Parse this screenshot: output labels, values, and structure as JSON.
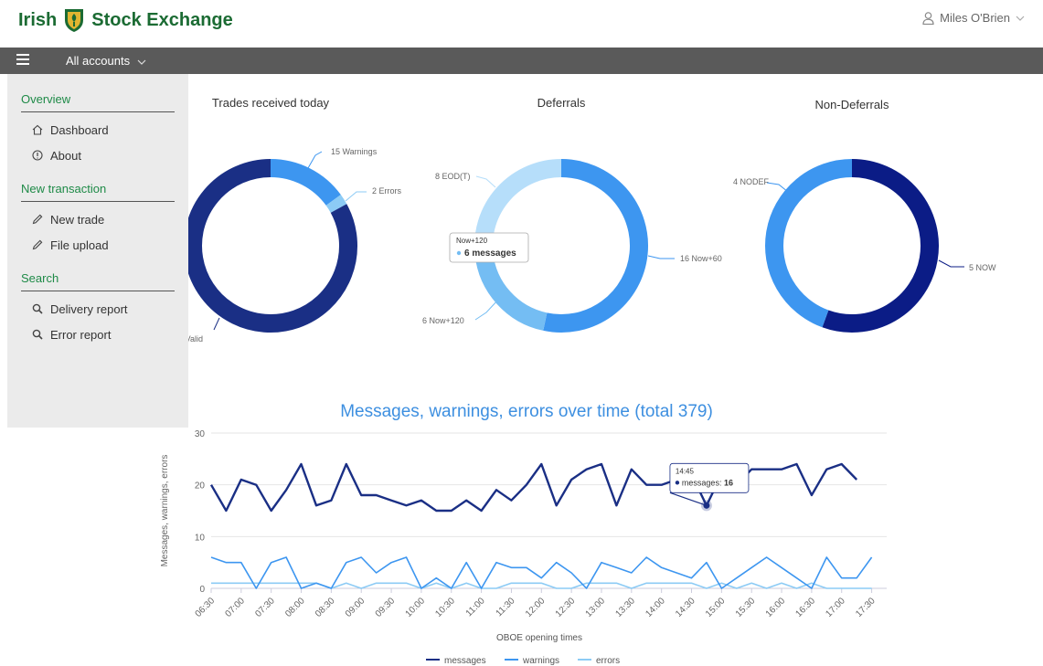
{
  "header": {
    "logo_left": "Irish",
    "logo_right": "Stock Exchange",
    "user_name": "Miles O'Brien"
  },
  "navbar": {
    "accounts_label": "All accounts"
  },
  "sidebar": {
    "sections": [
      {
        "title": "Overview",
        "items": [
          {
            "label": "Dashboard",
            "icon": "home-icon"
          },
          {
            "label": "About",
            "icon": "info-icon"
          }
        ]
      },
      {
        "title": "New transaction",
        "items": [
          {
            "label": "New trade",
            "icon": "pencil-icon"
          },
          {
            "label": "File upload",
            "icon": "pencil-icon"
          }
        ]
      },
      {
        "title": "Search",
        "items": [
          {
            "label": "Delivery report",
            "icon": "search-icon"
          },
          {
            "label": "Error report",
            "icon": "search-icon"
          }
        ]
      }
    ]
  },
  "colors": {
    "dark_blue": "#1a2f85",
    "mid_blue": "#3d96f0",
    "light_blue": "#8ccbf5",
    "navy": "#0b1c86",
    "title_blue": "#3d8fe0"
  },
  "chart_data": [
    {
      "type": "pie",
      "variant": "donut",
      "title": "Trades received today",
      "slices": [
        {
          "label": "Valid",
          "value": 83,
          "color": "#1a2f85"
        },
        {
          "label": "15 Warnings",
          "value": 15,
          "color": "#3d96f0"
        },
        {
          "label": "2 Errors",
          "value": 2,
          "color": "#8ccbf5"
        }
      ]
    },
    {
      "type": "pie",
      "variant": "donut",
      "title": "Deferrals",
      "tooltip": {
        "header": "Now+120",
        "value": "6 messages"
      },
      "slices": [
        {
          "label": "16 Now+60",
          "value": 16,
          "color": "#3d96f0"
        },
        {
          "label": "6 Now+120",
          "value": 6,
          "color": "#74bdf3"
        },
        {
          "label": "8 EOD(T)",
          "value": 8,
          "color": "#b6defa"
        }
      ]
    },
    {
      "type": "pie",
      "variant": "donut",
      "title": "Non-Deferrals",
      "slices": [
        {
          "label": "5 NOW",
          "value": 5,
          "color": "#0b1c86"
        },
        {
          "label": "4 NODEF",
          "value": 4,
          "color": "#3d96f0"
        }
      ]
    },
    {
      "type": "line",
      "title": "Messages, warnings, errors over time (total 379)",
      "xlabel": "OBOE opening times",
      "ylabel": "Messages, warnings, errors",
      "ylim": [
        0,
        30
      ],
      "yticks": [
        0,
        10,
        20,
        30
      ],
      "x": [
        "06:30",
        "06:45",
        "07:00",
        "07:15",
        "07:30",
        "07:45",
        "08:00",
        "08:15",
        "08:30",
        "08:45",
        "09:00",
        "09:15",
        "09:30",
        "09:45",
        "10:00",
        "10:15",
        "10:30",
        "10:45",
        "11:00",
        "11:15",
        "11:30",
        "11:45",
        "12:00",
        "12:15",
        "12:30",
        "12:45",
        "13:00",
        "13:15",
        "13:30",
        "13:45",
        "14:00",
        "14:15",
        "14:30",
        "14:45",
        "15:00",
        "15:15",
        "15:30",
        "15:45",
        "16:00",
        "16:15",
        "16:30",
        "16:45",
        "17:00",
        "17:15",
        "17:30",
        "17:45"
      ],
      "xtick_labels": [
        "06:30",
        "07:00",
        "07:30",
        "08:00",
        "08:30",
        "09:00",
        "09:30",
        "10:00",
        "10:30",
        "11:00",
        "11:30",
        "12:00",
        "12:30",
        "13:00",
        "13:30",
        "14:00",
        "14:30",
        "15:00",
        "15:30",
        "16:00",
        "16:30",
        "17:00",
        "17:30"
      ],
      "series": [
        {
          "name": "messages",
          "color": "#1a2f85",
          "width": 2.4,
          "values": [
            20,
            15,
            21,
            20,
            15,
            19,
            24,
            16,
            17,
            24,
            18,
            18,
            17,
            16,
            17,
            15,
            15,
            17,
            15,
            19,
            17,
            20,
            24,
            16,
            21,
            23,
            24,
            16,
            23,
            20,
            20,
            21,
            22,
            16,
            22,
            20,
            23,
            23,
            23,
            24,
            18,
            23,
            24,
            21,
            null,
            null
          ]
        },
        {
          "name": "warnings",
          "color": "#3d96f0",
          "width": 1.6,
          "values": [
            6,
            5,
            5,
            0,
            5,
            6,
            0,
            1,
            0,
            5,
            6,
            3,
            5,
            6,
            0,
            2,
            0,
            5,
            0,
            5,
            4,
            4,
            2,
            5,
            3,
            0,
            5,
            4,
            3,
            6,
            4,
            3,
            2,
            5,
            0,
            2,
            4,
            6,
            4,
            2,
            0,
            6,
            2,
            2,
            6,
            null
          ]
        },
        {
          "name": "errors",
          "color": "#8ccbf5",
          "width": 1.6,
          "values": [
            1,
            1,
            1,
            1,
            1,
            1,
            1,
            1,
            0,
            1,
            0,
            1,
            1,
            1,
            0,
            1,
            0,
            1,
            0,
            0,
            1,
            1,
            1,
            0,
            0,
            1,
            1,
            1,
            0,
            1,
            1,
            1,
            1,
            0,
            1,
            0,
            1,
            0,
            1,
            0,
            1,
            0,
            0,
            0,
            0,
            null
          ]
        }
      ],
      "tooltip": {
        "header": "14:45",
        "series": "messages",
        "value": "16"
      },
      "legend_position": "bottom",
      "grid": true
    }
  ]
}
